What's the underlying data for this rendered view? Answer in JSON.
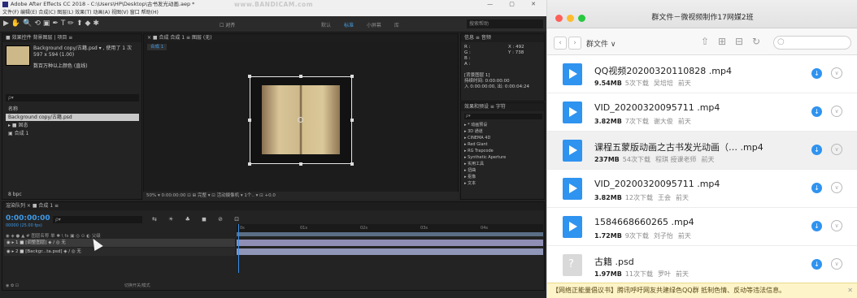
{
  "ae": {
    "title": "Adobe After Effects CC 2018 - C:\\Users\\HP\\Desktop\\古书发光动画.aep *",
    "watermark": "www.BANDICAM.com",
    "window_controls": "—  ▢  ✕",
    "menu": "文件(F)  编辑(E)  合成(C)  图层(L)  效果(T)  动画(A)  视图(V)  窗口  帮助(H)",
    "toolbar_icons": "▶✋🔍⟲▣✒T✏⬆◆✱",
    "snap": "☐ 对齐",
    "workspaces": "默认 标准 小屏幕 库",
    "workspace_active": "标准",
    "search_help": "搜索帮助",
    "project": {
      "header": "■ 效果控件 背景图层 |  项目 ≡",
      "item_name": "Background copy/古籍.psd ▾ , 使用了 1 次",
      "item_size": "597 x 594 (1.00)",
      "item_extra": "数百万种以上颜色 (直线)",
      "search": "ρ▾",
      "col_name": "名称",
      "row1": "Background copy/古籍.psd",
      "row2": "▸ ■ 固态",
      "row3": "▣ 合成 1",
      "footer": "8 bpc"
    },
    "viewer": {
      "header": "× ■ 合成 合成 1 ≡    图层 (无)",
      "tab": "合成 1",
      "footer": "50%  ▾  0:00:00:00  ⊡ ⊞ 完整  ▾  ⊡ 活动摄像机  ▾ 1个..  ▾ ⊡ +0.0"
    },
    "info": {
      "header": "信息 ≡  音频",
      "lines": [
        "R :",
        "G :",
        "B :",
        "A :",
        "X : 492",
        "Y : 738",
        "",
        "[背景图层 1]",
        "持续时间: 0:00:00:00",
        "入 0:00:00:00, 出: 0:00:04:24"
      ]
    },
    "effects": {
      "header": "效果和预设 ≡  字符",
      "search": "ρ▾",
      "lines": [
        "▸ * 动画预设",
        "▸ 3D 通道",
        "▸ CINEMA 4D",
        "▸ Red Giant",
        "▸ RG Trapcode",
        "▸ Synthetic Aperture",
        "▸ 实用工具",
        "▸ 扭曲",
        "▸ 抠像",
        "▸ 文本"
      ]
    },
    "timeline": {
      "header": "渲染队列   × ■ 合成 1 ≡",
      "timecode": "0:00:00:00",
      "sub": "00000 (25.00 fps)",
      "search": "ρ▾",
      "icons": "⇆ ☀ ♣ ◼ ⊘ ⊡",
      "cols": "◉ ◈ ● ▲  #  图层名称           单 ✱ \\ fx ▣ ◎ ⊙ ◐    父级",
      "layer1": "◉     ▸ 1   ■ [调整图层]     ◈  /        ◎  无",
      "layer2": "◉     ▸ 2   ■ [Backgr...ta.psd]  ◈  /        ◎  无",
      "ruler": [
        "0s",
        "01s",
        "02s",
        "03s",
        "04s"
      ],
      "footer_left": "◉ ✿ ⊡",
      "footer_mid": "切换开关/模式"
    }
  },
  "wechat": {
    "title": "群文件－微视频制作17网媒2班",
    "breadcrumb": "群文件 ∨",
    "search_placeholder": "",
    "files": [
      {
        "name": "QQ视频20200320110828 .mp4",
        "size": "9.54MB",
        "downloads": "5次下载",
        "uploader": "吴培培",
        "time": "前天",
        "type": "video"
      },
      {
        "name": "VID_20200320095711 .mp4",
        "size": "3.82MB",
        "downloads": "7次下载",
        "uploader": "谢大俊",
        "time": "前天",
        "type": "video"
      },
      {
        "name": "课程五蒙版动画之古书发光动画（… .mp4",
        "size": "237MB",
        "downloads": "54次下载",
        "uploader": "程琪 授课老师",
        "time": "前天",
        "type": "video"
      },
      {
        "name": "VID_20200320095711 .mp4",
        "size": "3.82MB",
        "downloads": "12次下载",
        "uploader": "王会",
        "time": "前天",
        "type": "video"
      },
      {
        "name": "1584668660265 .mp4",
        "size": "1.72MB",
        "downloads": "9次下载",
        "uploader": "刘子怡",
        "time": "前天",
        "type": "video"
      },
      {
        "name": "古籍 .psd",
        "size": "1.97MB",
        "downloads": "11次下载",
        "uploader": "罗叶",
        "time": "前天",
        "type": "doc"
      }
    ],
    "notice": "【网络正能量倡议书】腾讯呼吁网友共建绿色QQ群 抵制色情、反动等违法信息。",
    "colors": {
      "accent": "#2f93f0",
      "red": "#fe5f57",
      "yellow": "#febc2e",
      "green": "#28c840"
    }
  }
}
